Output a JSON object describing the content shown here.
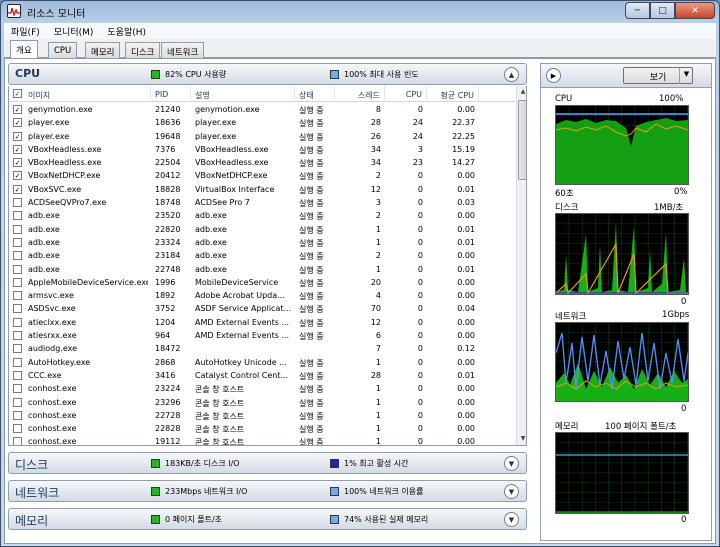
{
  "window": {
    "title": "리소스 모니터",
    "min": "─",
    "max": "□",
    "close": "✕"
  },
  "menu": [
    "파일(F)",
    "모니터(M)",
    "도움말(H)"
  ],
  "tabs": [
    "개요",
    "CPU",
    "메모리",
    "디스크",
    "네트워크"
  ],
  "cpu_section": {
    "title": "CPU",
    "usage_text": "82% CPU 사용량",
    "freq_text": "100% 최대 사용 빈도",
    "usage_color": "#22b822",
    "freq_color": "#6ab0f0"
  },
  "columns": [
    "이미지",
    "PID",
    "설명",
    "상태",
    "스레드",
    "CPU",
    "평균 CPU"
  ],
  "processes": [
    {
      "checked": true,
      "image": "genymotion.exe",
      "pid": "21240",
      "desc": "genymotion.exe",
      "status": "실행 중",
      "threads": "8",
      "cpu": "0",
      "avg": "0.00"
    },
    {
      "checked": true,
      "image": "player.exe",
      "pid": "18636",
      "desc": "player.exe",
      "status": "실행 중",
      "threads": "28",
      "cpu": "24",
      "avg": "22.37"
    },
    {
      "checked": true,
      "image": "player.exe",
      "pid": "19648",
      "desc": "player.exe",
      "status": "실행 중",
      "threads": "26",
      "cpu": "24",
      "avg": "22.25"
    },
    {
      "checked": true,
      "image": "VBoxHeadless.exe",
      "pid": "7376",
      "desc": "VBoxHeadless.exe",
      "status": "실행 중",
      "threads": "34",
      "cpu": "3",
      "avg": "15.19"
    },
    {
      "checked": true,
      "image": "VBoxHeadless.exe",
      "pid": "22504",
      "desc": "VBoxHeadless.exe",
      "status": "실행 중",
      "threads": "34",
      "cpu": "23",
      "avg": "14.27"
    },
    {
      "checked": true,
      "image": "VBoxNetDHCP.exe",
      "pid": "20412",
      "desc": "VBoxNetDHCP.exe",
      "status": "실행 중",
      "threads": "2",
      "cpu": "0",
      "avg": "0.00"
    },
    {
      "checked": true,
      "image": "VBoxSVC.exe",
      "pid": "18828",
      "desc": "VirtualBox Interface",
      "status": "실행 중",
      "threads": "12",
      "cpu": "0",
      "avg": "0.01"
    },
    {
      "checked": false,
      "image": "ACDSeeQVPro7.exe",
      "pid": "18748",
      "desc": "ACDSee Pro 7",
      "status": "실행 중",
      "threads": "3",
      "cpu": "0",
      "avg": "0.03"
    },
    {
      "checked": false,
      "image": "adb.exe",
      "pid": "23520",
      "desc": "adb.exe",
      "status": "실행 중",
      "threads": "2",
      "cpu": "0",
      "avg": "0.00"
    },
    {
      "checked": false,
      "image": "adb.exe",
      "pid": "22820",
      "desc": "adb.exe",
      "status": "실행 중",
      "threads": "1",
      "cpu": "0",
      "avg": "0.01"
    },
    {
      "checked": false,
      "image": "adb.exe",
      "pid": "23324",
      "desc": "adb.exe",
      "status": "실행 중",
      "threads": "1",
      "cpu": "0",
      "avg": "0.01"
    },
    {
      "checked": false,
      "image": "adb.exe",
      "pid": "23184",
      "desc": "adb.exe",
      "status": "실행 중",
      "threads": "2",
      "cpu": "0",
      "avg": "0.00"
    },
    {
      "checked": false,
      "image": "adb.exe",
      "pid": "22748",
      "desc": "adb.exe",
      "status": "실행 중",
      "threads": "1",
      "cpu": "0",
      "avg": "0.01"
    },
    {
      "checked": false,
      "image": "AppleMobileDeviceService.exe",
      "pid": "1996",
      "desc": "MobileDeviceService",
      "status": "실행 중",
      "threads": "20",
      "cpu": "0",
      "avg": "0.00"
    },
    {
      "checked": false,
      "image": "armsvc.exe",
      "pid": "1892",
      "desc": "Adobe Acrobat Upda...",
      "status": "실행 중",
      "threads": "4",
      "cpu": "0",
      "avg": "0.00"
    },
    {
      "checked": false,
      "image": "ASDSvc.exe",
      "pid": "3752",
      "desc": "ASDF Service Applicat...",
      "status": "실행 중",
      "threads": "70",
      "cpu": "0",
      "avg": "0.04"
    },
    {
      "checked": false,
      "image": "atieclxx.exe",
      "pid": "1204",
      "desc": "AMD External Events ...",
      "status": "실행 중",
      "threads": "12",
      "cpu": "0",
      "avg": "0.00"
    },
    {
      "checked": false,
      "image": "atiesrxx.exe",
      "pid": "964",
      "desc": "AMD External Events ...",
      "status": "실행 중",
      "threads": "6",
      "cpu": "0",
      "avg": "0.00"
    },
    {
      "checked": false,
      "image": "audiodg.exe",
      "pid": "18472",
      "desc": "",
      "status": "",
      "threads": "7",
      "cpu": "0",
      "avg": "0.12"
    },
    {
      "checked": false,
      "image": "AutoHotkey.exe",
      "pid": "2868",
      "desc": "AutoHotkey Unicode ...",
      "status": "실행 중",
      "threads": "1",
      "cpu": "0",
      "avg": "0.00"
    },
    {
      "checked": false,
      "image": "CCC.exe",
      "pid": "3416",
      "desc": "Catalyst Control Cent...",
      "status": "실행 중",
      "threads": "28",
      "cpu": "0",
      "avg": "0.01"
    },
    {
      "checked": false,
      "image": "conhost.exe",
      "pid": "23224",
      "desc": "콘솔 창 호스트",
      "status": "실행 중",
      "threads": "1",
      "cpu": "0",
      "avg": "0.00"
    },
    {
      "checked": false,
      "image": "conhost.exe",
      "pid": "23296",
      "desc": "콘솔 창 호스트",
      "status": "실행 중",
      "threads": "1",
      "cpu": "0",
      "avg": "0.00"
    },
    {
      "checked": false,
      "image": "conhost.exe",
      "pid": "22728",
      "desc": "콘솔 창 호스트",
      "status": "실행 중",
      "threads": "1",
      "cpu": "0",
      "avg": "0.00"
    },
    {
      "checked": false,
      "image": "conhost.exe",
      "pid": "22828",
      "desc": "콘솔 창 호스트",
      "status": "실행 중",
      "threads": "1",
      "cpu": "0",
      "avg": "0.00"
    },
    {
      "checked": false,
      "image": "conhost.exe",
      "pid": "19112",
      "desc": "콘솔 창 호스트",
      "status": "실행 중",
      "threads": "1",
      "cpu": "0",
      "avg": "0.00"
    }
  ],
  "disk_section": {
    "title": "디스크",
    "text1": "183KB/초 디스크 I/O",
    "text2": "1% 최고 활성 시간",
    "c1": "#22b822",
    "c2": "#1a2ab0"
  },
  "net_section": {
    "title": "네트워크",
    "text1": "233Mbps 네트워크 I/O",
    "text2": "100% 네트워크 이용률",
    "c1": "#22b822",
    "c2": "#6ab0f0"
  },
  "mem_section": {
    "title": "메모리",
    "text1": "0 페이지 폴트/초",
    "text2": "74% 사용된 실제 메모리",
    "c1": "#22b822",
    "c2": "#6ab0f0"
  },
  "right_panel": {
    "view_label": "보기",
    "cpu": {
      "name": "CPU",
      "max": "100%",
      "time": "60초",
      "min": "0%"
    },
    "disk": {
      "name": "디스크",
      "max": "1MB/초",
      "min": "0"
    },
    "net": {
      "name": "네트워크",
      "max": "1Gbps",
      "min": "0"
    },
    "mem": {
      "name": "메모리",
      "max": "100 페이지 폴트/초",
      "min": "0"
    }
  }
}
